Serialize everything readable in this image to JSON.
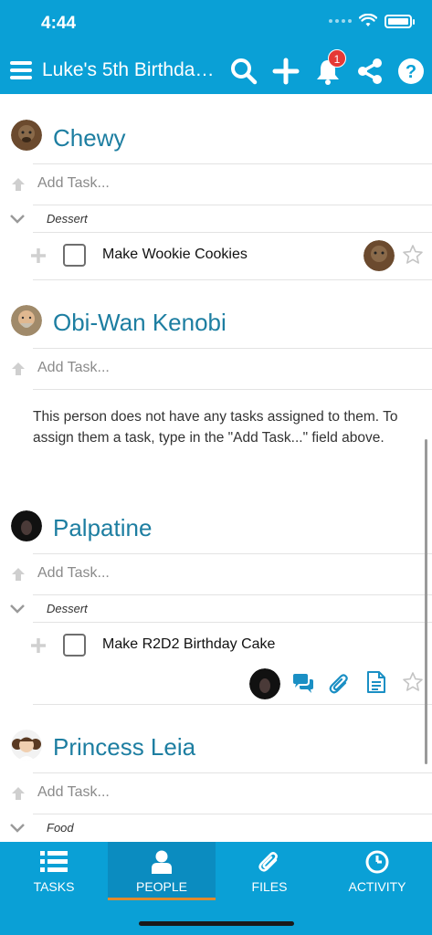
{
  "status": {
    "time": "4:44"
  },
  "header": {
    "title": "Luke's 5th Birthda…",
    "notification_count": "1"
  },
  "people": [
    {
      "name": "Chewy",
      "add_placeholder": "Add Task...",
      "category": "Dessert",
      "task": "Make Wookie Cookies"
    },
    {
      "name": "Obi-Wan Kenobi",
      "add_placeholder": "Add Task...",
      "empty_note": "This person does not have any tasks assigned to them. To assign them a task, type in the \"Add Task...\" field above."
    },
    {
      "name": "Palpatine",
      "add_placeholder": "Add Task...",
      "category": "Dessert",
      "task": "Make R2D2 Birthday Cake"
    },
    {
      "name": "Princess Leia",
      "add_placeholder": "Add Task...",
      "category": "Food"
    }
  ],
  "nav": [
    {
      "label": "TASKS",
      "icon": "list-icon"
    },
    {
      "label": "PEOPLE",
      "icon": "person-icon",
      "active": true
    },
    {
      "label": "FILES",
      "icon": "paperclip-icon"
    },
    {
      "label": "ACTIVITY",
      "icon": "clock-icon"
    }
  ],
  "colors": {
    "brand": "#0aa0d6",
    "name": "#1d7ea1",
    "active_underline": "#e08a2e",
    "badge": "#e53935"
  }
}
